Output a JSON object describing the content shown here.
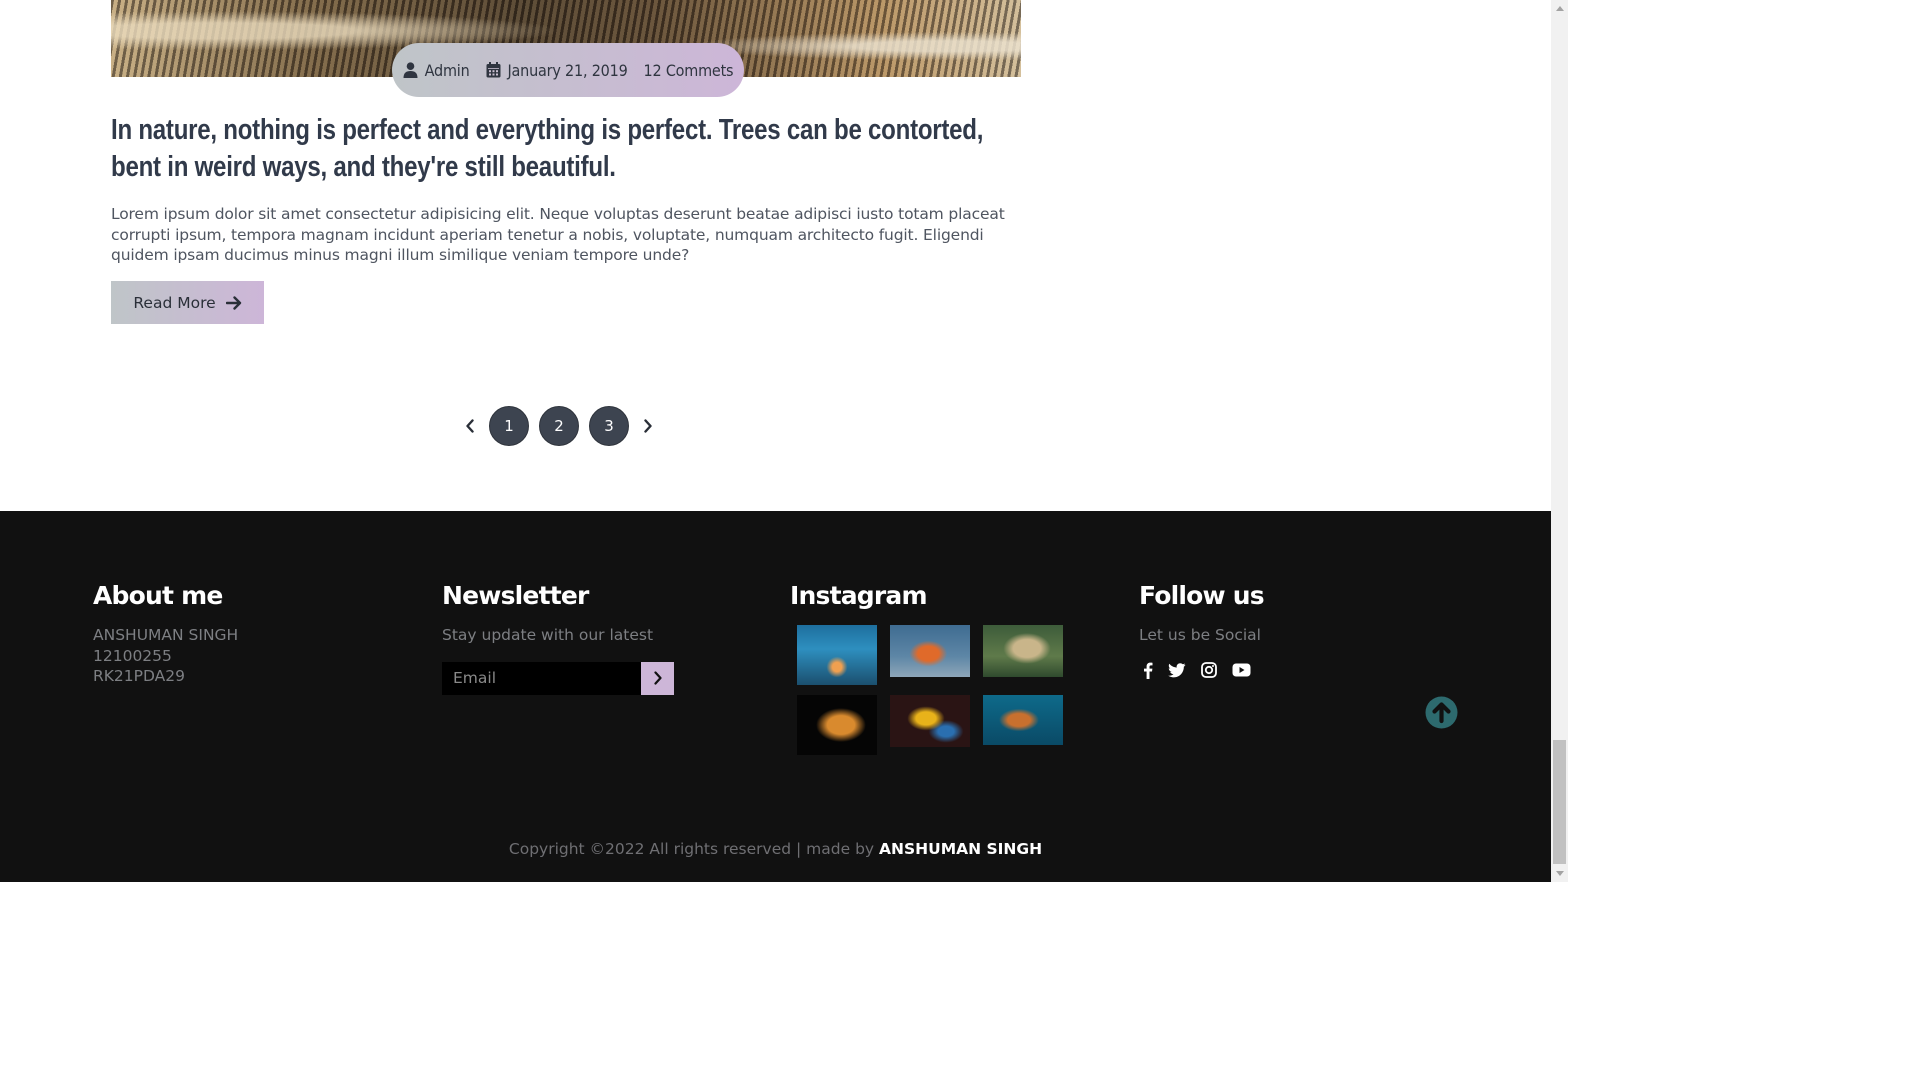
{
  "post": {
    "author": "Admin",
    "date": "January 21, 2019",
    "comments": "12 Commets",
    "title": "In nature, nothing is perfect and everything is perfect. Trees can be contorted, bent in weird ways, and they're still beautiful.",
    "excerpt": "Lorem ipsum dolor sit amet consectetur adipisicing elit. Neque voluptas deserunt beatae adipisci iusto totam placeat corrupti ipsum, tempora magnam incidunt aperiam tenetur a nobis, voluptate, numquam architecto fugit. Eligendi quidem ipsam ducimus minus magni illum similique veniam tempore unde?",
    "read_more_label": "Read More"
  },
  "pagination": {
    "pages": [
      "1",
      "2",
      "3"
    ]
  },
  "footer": {
    "about": {
      "heading": "About me",
      "lines": [
        "ANSHUMAN SINGH",
        "12100255",
        "RK21PDA29"
      ]
    },
    "newsletter": {
      "heading": "Newsletter",
      "text": "Stay update with our latest",
      "email_placeholder": "Email"
    },
    "instagram": {
      "heading": "Instagram",
      "images": [
        "coral-reef",
        "fox",
        "leopard",
        "tiger",
        "parrot",
        "sea-turtle"
      ]
    },
    "follow": {
      "heading": "Follow us",
      "text": "Let us be Social",
      "icons": [
        "facebook-icon",
        "twitter-icon",
        "instagram-icon",
        "youtube-icon"
      ]
    },
    "copyright_prefix": "Copyright ©2022 All rights reserved | made by ",
    "copyright_name": "ANSHUMAN SINGH"
  },
  "colors": {
    "accent_start": "#bfc5c8",
    "accent_end": "#cdb6d8",
    "footer_bg": "#111111",
    "pagination_bg": "#3d4450",
    "back_to_top": "#2d6a6e"
  }
}
